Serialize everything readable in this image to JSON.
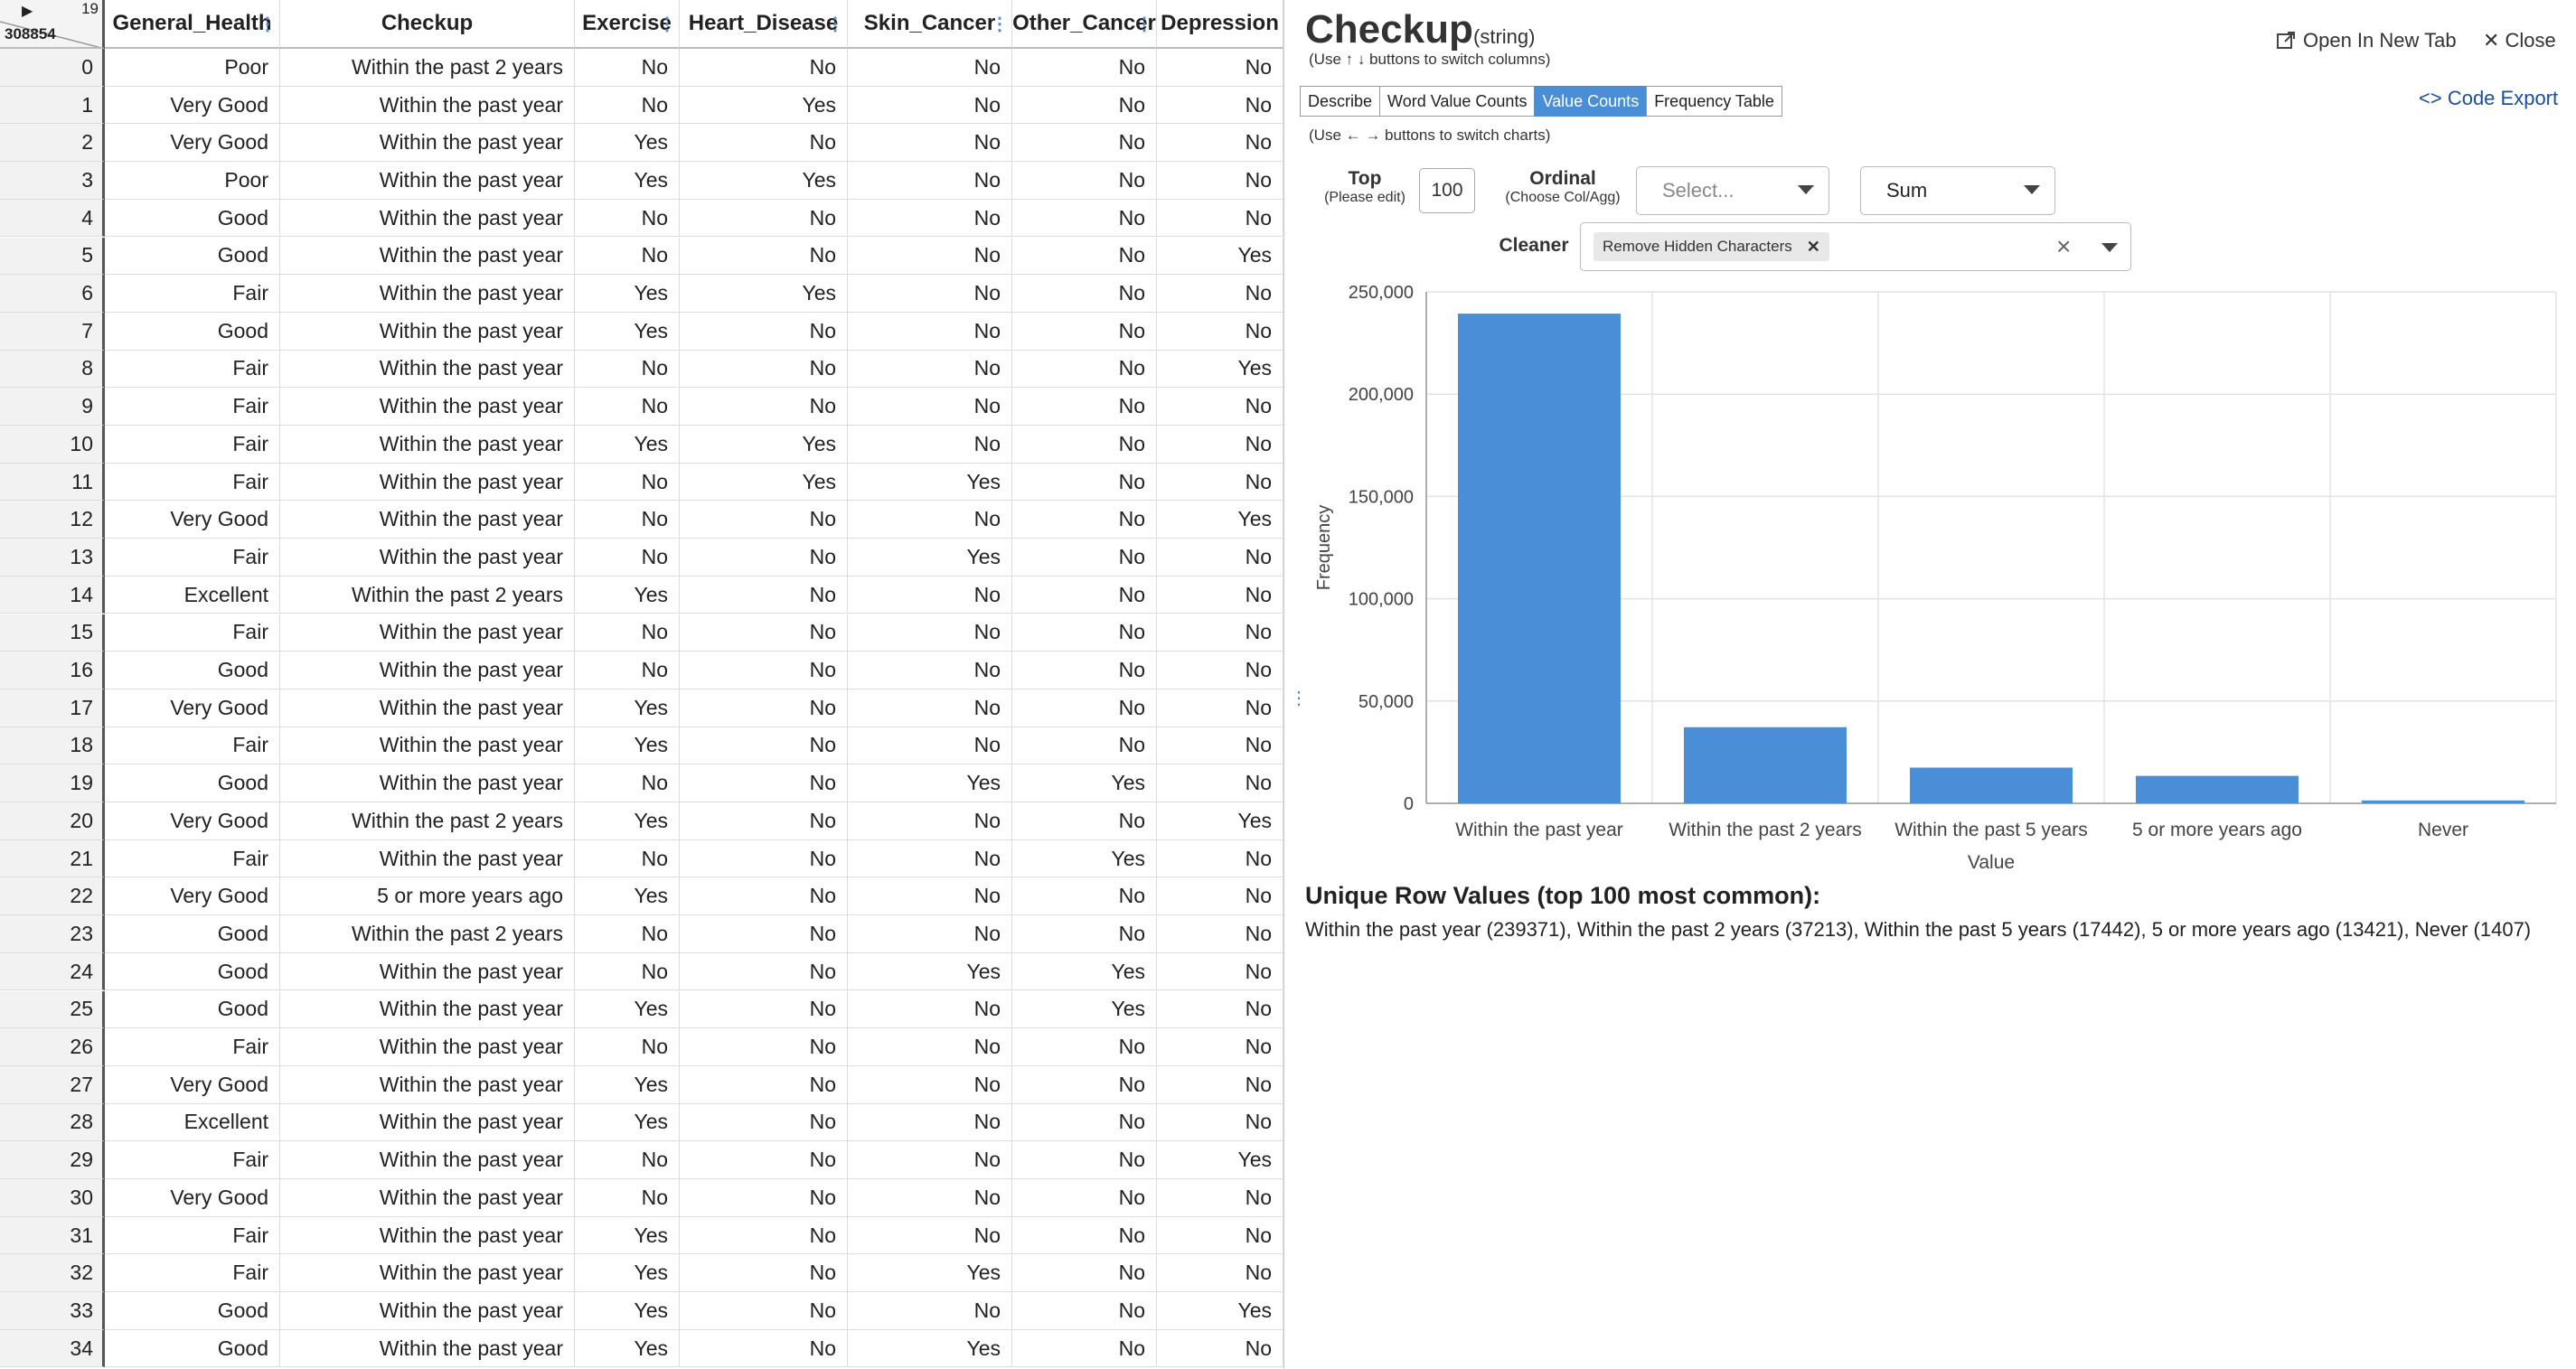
{
  "grid": {
    "corner": {
      "col_count": "19",
      "row_count": "308854"
    },
    "columns": [
      "General_Health",
      "Checkup",
      "Exercise",
      "Heart_Disease",
      "Skin_Cancer",
      "Other_Cancer",
      "Depression"
    ],
    "rows": [
      [
        "0",
        "Poor",
        "Within the past 2 years",
        "No",
        "No",
        "No",
        "No",
        "No"
      ],
      [
        "1",
        "Very Good",
        "Within the past year",
        "No",
        "Yes",
        "No",
        "No",
        "No"
      ],
      [
        "2",
        "Very Good",
        "Within the past year",
        "Yes",
        "No",
        "No",
        "No",
        "No"
      ],
      [
        "3",
        "Poor",
        "Within the past year",
        "Yes",
        "Yes",
        "No",
        "No",
        "No"
      ],
      [
        "4",
        "Good",
        "Within the past year",
        "No",
        "No",
        "No",
        "No",
        "No"
      ],
      [
        "5",
        "Good",
        "Within the past year",
        "No",
        "No",
        "No",
        "No",
        "Yes"
      ],
      [
        "6",
        "Fair",
        "Within the past year",
        "Yes",
        "Yes",
        "No",
        "No",
        "No"
      ],
      [
        "7",
        "Good",
        "Within the past year",
        "Yes",
        "No",
        "No",
        "No",
        "No"
      ],
      [
        "8",
        "Fair",
        "Within the past year",
        "No",
        "No",
        "No",
        "No",
        "Yes"
      ],
      [
        "9",
        "Fair",
        "Within the past year",
        "No",
        "No",
        "No",
        "No",
        "No"
      ],
      [
        "10",
        "Fair",
        "Within the past year",
        "Yes",
        "Yes",
        "No",
        "No",
        "No"
      ],
      [
        "11",
        "Fair",
        "Within the past year",
        "No",
        "Yes",
        "Yes",
        "No",
        "No"
      ],
      [
        "12",
        "Very Good",
        "Within the past year",
        "No",
        "No",
        "No",
        "No",
        "Yes"
      ],
      [
        "13",
        "Fair",
        "Within the past year",
        "No",
        "No",
        "Yes",
        "No",
        "No"
      ],
      [
        "14",
        "Excellent",
        "Within the past 2 years",
        "Yes",
        "No",
        "No",
        "No",
        "No"
      ],
      [
        "15",
        "Fair",
        "Within the past year",
        "No",
        "No",
        "No",
        "No",
        "No"
      ],
      [
        "16",
        "Good",
        "Within the past year",
        "No",
        "No",
        "No",
        "No",
        "No"
      ],
      [
        "17",
        "Very Good",
        "Within the past year",
        "Yes",
        "No",
        "No",
        "No",
        "No"
      ],
      [
        "18",
        "Fair",
        "Within the past year",
        "Yes",
        "No",
        "No",
        "No",
        "No"
      ],
      [
        "19",
        "Good",
        "Within the past year",
        "No",
        "No",
        "Yes",
        "Yes",
        "No"
      ],
      [
        "20",
        "Very Good",
        "Within the past 2 years",
        "Yes",
        "No",
        "No",
        "No",
        "Yes"
      ],
      [
        "21",
        "Fair",
        "Within the past year",
        "No",
        "No",
        "No",
        "Yes",
        "No"
      ],
      [
        "22",
        "Very Good",
        "5 or more years ago",
        "Yes",
        "No",
        "No",
        "No",
        "No"
      ],
      [
        "23",
        "Good",
        "Within the past 2 years",
        "No",
        "No",
        "No",
        "No",
        "No"
      ],
      [
        "24",
        "Good",
        "Within the past year",
        "No",
        "No",
        "Yes",
        "Yes",
        "No"
      ],
      [
        "25",
        "Good",
        "Within the past year",
        "Yes",
        "No",
        "No",
        "Yes",
        "No"
      ],
      [
        "26",
        "Fair",
        "Within the past year",
        "No",
        "No",
        "No",
        "No",
        "No"
      ],
      [
        "27",
        "Very Good",
        "Within the past year",
        "Yes",
        "No",
        "No",
        "No",
        "No"
      ],
      [
        "28",
        "Excellent",
        "Within the past year",
        "Yes",
        "No",
        "No",
        "No",
        "No"
      ],
      [
        "29",
        "Fair",
        "Within the past year",
        "No",
        "No",
        "No",
        "No",
        "Yes"
      ],
      [
        "30",
        "Very Good",
        "Within the past year",
        "No",
        "No",
        "No",
        "No",
        "No"
      ],
      [
        "31",
        "Fair",
        "Within the past year",
        "Yes",
        "No",
        "No",
        "No",
        "No"
      ],
      [
        "32",
        "Fair",
        "Within the past year",
        "Yes",
        "No",
        "Yes",
        "No",
        "No"
      ],
      [
        "33",
        "Good",
        "Within the past year",
        "Yes",
        "No",
        "No",
        "No",
        "Yes"
      ],
      [
        "34",
        "Good",
        "Within the past year",
        "Yes",
        "No",
        "Yes",
        "No",
        "No"
      ]
    ]
  },
  "panel": {
    "title": "Checkup",
    "dtype": "(string)",
    "column_hint": "(Use ↑ ↓ buttons to switch columns)",
    "open_new_tab": "Open In New Tab",
    "close": "Close",
    "tabs": [
      {
        "label": "Describe",
        "active": false
      },
      {
        "label": "Word Value Counts",
        "active": false
      },
      {
        "label": "Value Counts",
        "active": true
      },
      {
        "label": "Frequency Table",
        "active": false
      }
    ],
    "chart_hint": "(Use ← → buttons to switch charts)",
    "code_export": "Code Export",
    "controls": {
      "top_label": "Top",
      "top_sub": "(Please edit)",
      "top_value": "100",
      "ordinal_label": "Ordinal",
      "ordinal_sub": "(Choose Col/Agg)",
      "ordinal_placeholder": "Select...",
      "agg_value": "Sum",
      "cleaner_label": "Cleaner",
      "cleaner_chip": "Remove Hidden Characters"
    },
    "unique_title": "Unique Row Values (top 100 most common):",
    "unique_values": "Within the past year (239371), Within the past 2 years (37213), Within the past 5 years (17442), 5 or more years ago (13421), Never (1407)"
  },
  "colors": {
    "accent": "#4a8ed8",
    "bar": "#4a8ed8",
    "link": "#1a4fa0"
  },
  "chart_data": {
    "type": "bar",
    "categories": [
      "Within the past year",
      "Within the past 2 years",
      "Within the past 5 years",
      "5 or more years ago",
      "Never"
    ],
    "values": [
      239371,
      37213,
      17442,
      13421,
      1407
    ],
    "xlabel": "Value",
    "ylabel": "Frequency",
    "ylim": [
      0,
      250000
    ],
    "yticks": [
      0,
      50000,
      100000,
      150000,
      200000,
      250000
    ],
    "ytick_labels": [
      "0",
      "50,000",
      "100,000",
      "150,000",
      "200,000",
      "250,000"
    ],
    "grid": true,
    "legend": "none"
  }
}
